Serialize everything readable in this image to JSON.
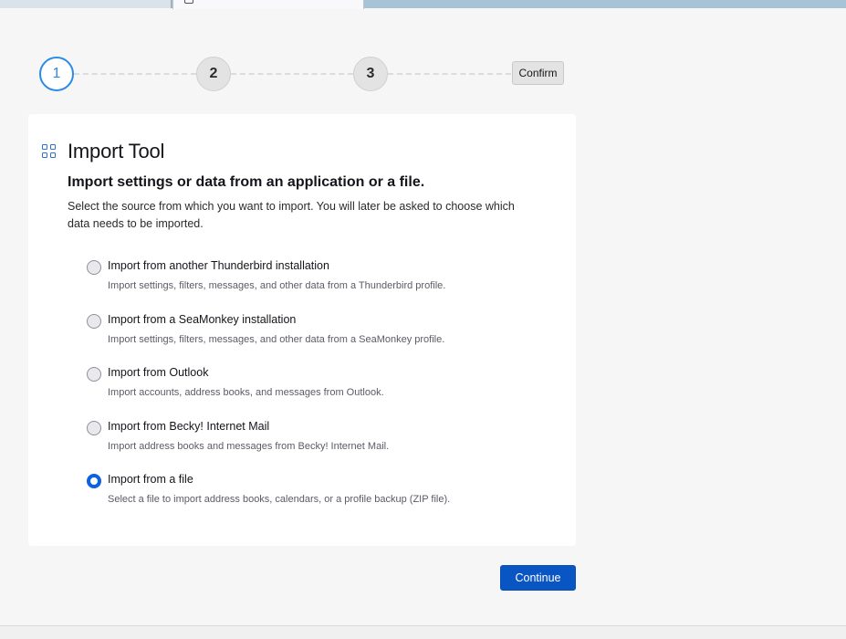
{
  "stepper": {
    "steps": [
      "1",
      "2",
      "3"
    ],
    "confirm_label": "Confirm",
    "active_step": 1
  },
  "card": {
    "icon": "grid-icon",
    "title": "Import Tool",
    "subtitle": "Import settings or data from an application or a file.",
    "description": "Select the source from which you want to import. You will later be asked to choose which data needs to be imported."
  },
  "options": [
    {
      "label": "Import from another Thunderbird installation",
      "description": "Import settings, filters, messages, and other data from a Thunderbird profile.",
      "checked": false
    },
    {
      "label": "Import from a SeaMonkey installation",
      "description": "Import settings, filters, messages, and other data from a SeaMonkey profile.",
      "checked": false
    },
    {
      "label": "Import from Outlook",
      "description": "Import accounts, address books, and messages from Outlook.",
      "checked": false
    },
    {
      "label": "Import from Becky! Internet Mail",
      "description": "Import address books and messages from Becky! Internet Mail.",
      "checked": false
    },
    {
      "label": "Import from a file",
      "description": "Select a file to import address books, calendars, or a profile backup (ZIP file).",
      "checked": true
    }
  ],
  "footer": {
    "continue_label": "Continue"
  },
  "colors": {
    "accent": "#0a55c4",
    "step_active": "#2b8ae8"
  }
}
